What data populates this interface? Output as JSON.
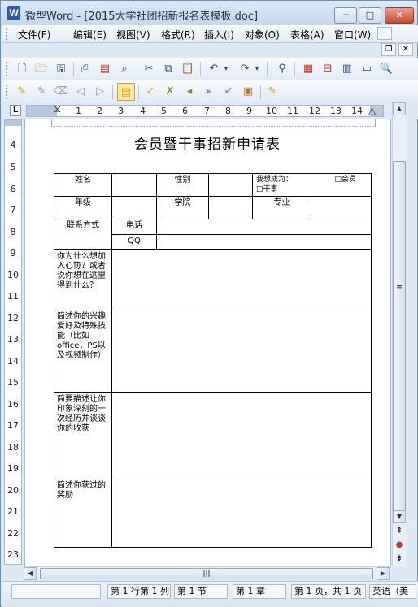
{
  "window": {
    "app_icon": "W",
    "title": "微型Word - [2015大学社团招新报名表模板.doc]",
    "minimize": "─",
    "maximize": "□",
    "close": "✕"
  },
  "menu": {
    "items": [
      "文件(F)",
      "编辑(E)",
      "视图(V)",
      "格式(R)",
      "插入(I)",
      "对象(O)",
      "表格(A)",
      "窗口(W)"
    ],
    "mdi_min": "–",
    "mdi_restore": "❐",
    "mdi_close": "✕"
  },
  "toolbar1": {
    "icons": [
      "new-document-icon",
      "open-folder-icon",
      "save-icon",
      "print-icon",
      "export-pdf-icon",
      "print-preview-icon",
      "cut-icon",
      "copy-icon",
      "paste-icon",
      "undo-icon",
      "redo-icon",
      "find-icon",
      "insert-table-icon",
      "insert-row-icon",
      "table-properties-icon",
      "page-view-icon",
      "zoom-icon"
    ]
  },
  "toolbar2": {
    "icons": [
      "new-comment-icon",
      "edit-comment-icon",
      "delete-comment-icon",
      "previous-comment-icon",
      "next-comment-icon",
      "track-changes-icon",
      "accept-change-icon",
      "reject-change-icon",
      "previous-change-icon",
      "next-change-icon",
      "accept-all-icon",
      "review-pane-icon"
    ]
  },
  "ruler": {
    "tab_label": "L",
    "h_numbers": [
      "1",
      "2",
      "3",
      "4",
      "5",
      "6",
      "7",
      "8",
      "9",
      "10",
      "11",
      "12",
      "13",
      "14"
    ],
    "v_numbers": [
      "4",
      "5",
      "6",
      "7",
      "8",
      "9",
      "10",
      "11",
      "12",
      "13",
      "14",
      "15",
      "16",
      "17",
      "18",
      "19",
      "20",
      "21",
      "22",
      "23"
    ]
  },
  "document": {
    "title": "会员暨干事招新申请表",
    "form": {
      "name_label": "姓名",
      "gender_label": "性别",
      "want_label": "我想成为：",
      "member_option": "□会员",
      "staff_option": "□干事",
      "grade_label": "年级",
      "college_label": "学院",
      "major_label": "专业",
      "contact_label": "联系方式",
      "phone_label": "电话",
      "qq_label": "QQ",
      "q1": "你为什么想加入心协？或者说你想在这里得到什么？",
      "q2": "简述你的兴趣爱好及特殊技能（比如office，PS以及视频制作）",
      "q3": "简要描述让你印象深刻的一次经历并谈谈你的收获",
      "q4": "简述你获过的奖励"
    }
  },
  "scrollbar": {
    "up": "▲",
    "down": "▼",
    "left": "◀",
    "right": "▶",
    "grip": "≡",
    "hgrip": "|||",
    "prev_page": "⇞",
    "select_browse": "●",
    "next_page": "⇟"
  },
  "status": {
    "cell1": "",
    "position": "第 1 行第 1 列",
    "section": "第 1 节",
    "chapter": "第 1 章",
    "page": "第 1 页，共 1 页",
    "language": "英语（美"
  }
}
